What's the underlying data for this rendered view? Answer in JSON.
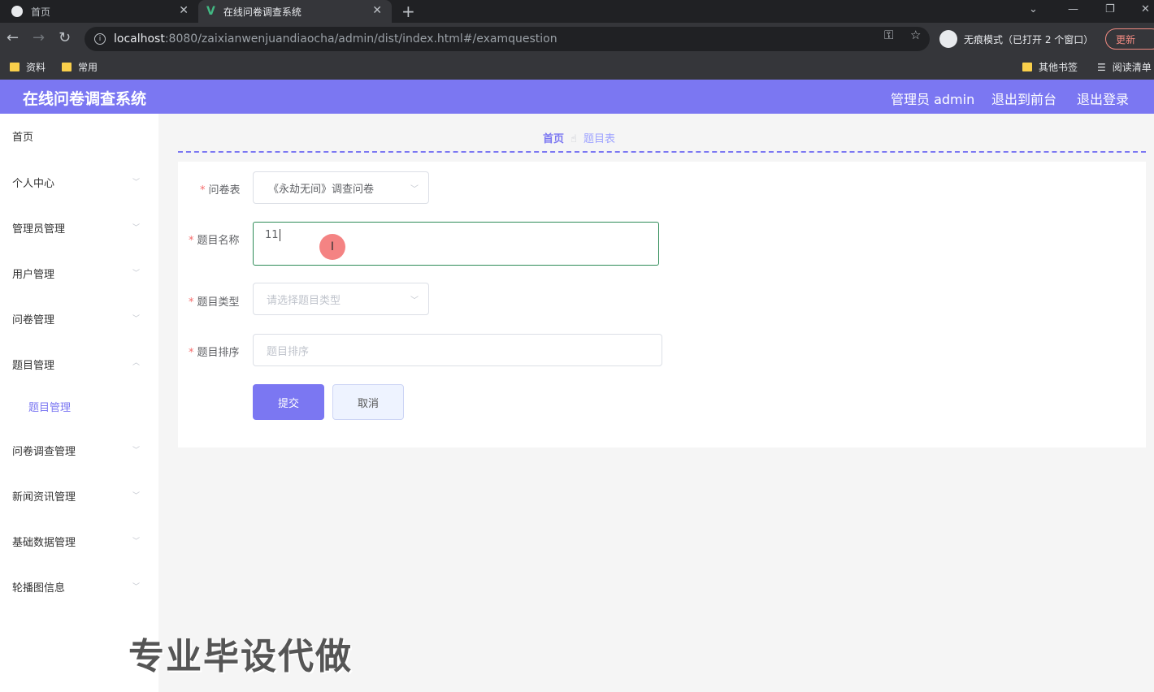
{
  "browser": {
    "tabs": [
      {
        "label": "首页"
      },
      {
        "label": "在线问卷调查系统"
      }
    ],
    "url_host": "localhost",
    "url_rest": ":8080/zaixianwenjuandiaocha/admin/dist/index.html#/examquestion",
    "incognito_label": "无痕模式（已打开 2 个窗口）",
    "update_label": "更新",
    "bookmarks": [
      {
        "label": "资料"
      },
      {
        "label": "常用"
      },
      {
        "label": "其他书签"
      },
      {
        "label": "阅读清单"
      }
    ]
  },
  "header": {
    "title": "在线问卷调查系统",
    "user": "管理员 admin",
    "to_front": "退出到前台",
    "logout": "退出登录",
    "color": "#7b77f2"
  },
  "sidebar": {
    "items": [
      {
        "label": "首页"
      },
      {
        "label": "个人中心"
      },
      {
        "label": "管理员管理"
      },
      {
        "label": "用户管理"
      },
      {
        "label": "问卷管理"
      },
      {
        "label": "题目管理"
      },
      {
        "label": "问卷调查管理"
      },
      {
        "label": "新闻资讯管理"
      },
      {
        "label": "基础数据管理"
      },
      {
        "label": "轮播图信息"
      }
    ],
    "active_sub": "题目管理"
  },
  "breadcrumb": {
    "home": "首页",
    "current": "题目表"
  },
  "form": {
    "questionnaire": {
      "label": "问卷表",
      "value": "《永劫无间》调查问卷"
    },
    "title": {
      "label": "题目名称",
      "value": "11"
    },
    "type": {
      "label": "题目类型",
      "placeholder": "请选择题目类型"
    },
    "order": {
      "label": "题目排序",
      "placeholder": "题目排序"
    },
    "submit": "提交",
    "cancel": "取消"
  },
  "watermark": "专业毕设代做"
}
